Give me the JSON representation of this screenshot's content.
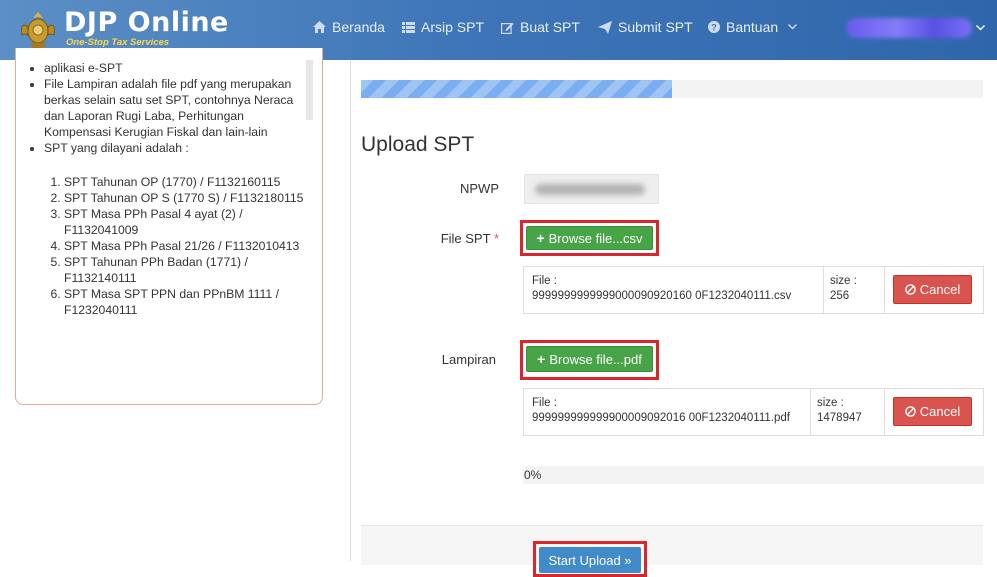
{
  "brand": {
    "title": "DJP Online",
    "tagline": "One-Stop Tax Services"
  },
  "nav": [
    {
      "label": "Beranda",
      "icon": "home-icon"
    },
    {
      "label": "Arsip SPT",
      "icon": "list-icon"
    },
    {
      "label": "Buat SPT",
      "icon": "edit-icon"
    },
    {
      "label": "Submit SPT",
      "icon": "send-icon"
    },
    {
      "label": "Bantuan",
      "icon": "question-circle-icon"
    }
  ],
  "colors": {
    "navbar": "#3f76b8",
    "success": "#47a447",
    "danger": "#d9534f",
    "primary": "#428bca",
    "highlight": "#d9252b"
  },
  "sidebar": {
    "bullets": [
      "aplikasi e-SPT",
      "File Lampiran adalah file pdf yang merupakan berkas selain satu set SPT, contohnya Neraca dan Laporan Rugi Laba, Perhitungan Kompensasi Kerugian Fiskal dan lain-lain",
      "SPT yang dilayani adalah :"
    ],
    "spt_list": [
      "SPT Tahunan OP (1770) / F1132160115",
      "SPT Tahunan OP S (1770 S) / F1132180115",
      "SPT Masa PPh Pasal 4 ayat (2) / F1132041009",
      "SPT Masa PPh Pasal 21/26 / F1132010413",
      "SPT Tahunan PPh Badan (1771) / F1132140111",
      "SPT Masa SPT PPN dan PPnBM 1111 / F1232040111"
    ]
  },
  "upload": {
    "top_progress_fraction": 0.5,
    "title": "Upload SPT",
    "npwp_label": "NPWP",
    "file_spt_label": "File SPT",
    "required_mark": "*",
    "browse_csv_label": "Browse file...csv",
    "csv_file": {
      "file_label": "File :",
      "file_name": "9999999999999000090920160 0F1232040111.csv",
      "size_label": "size :",
      "size": "256",
      "cancel_label": "Cancel"
    },
    "lampiran_label": "Lampiran",
    "browse_pdf_label": "Browse file...pdf",
    "pdf_file": {
      "file_label": "File :",
      "file_name": "999999999999900009092016 00F1232040111.pdf",
      "size_label": "size :",
      "size": "1478947",
      "cancel_label": "Cancel"
    },
    "bottom_progress_text": "0%",
    "start_upload_label": "Start Upload »"
  }
}
